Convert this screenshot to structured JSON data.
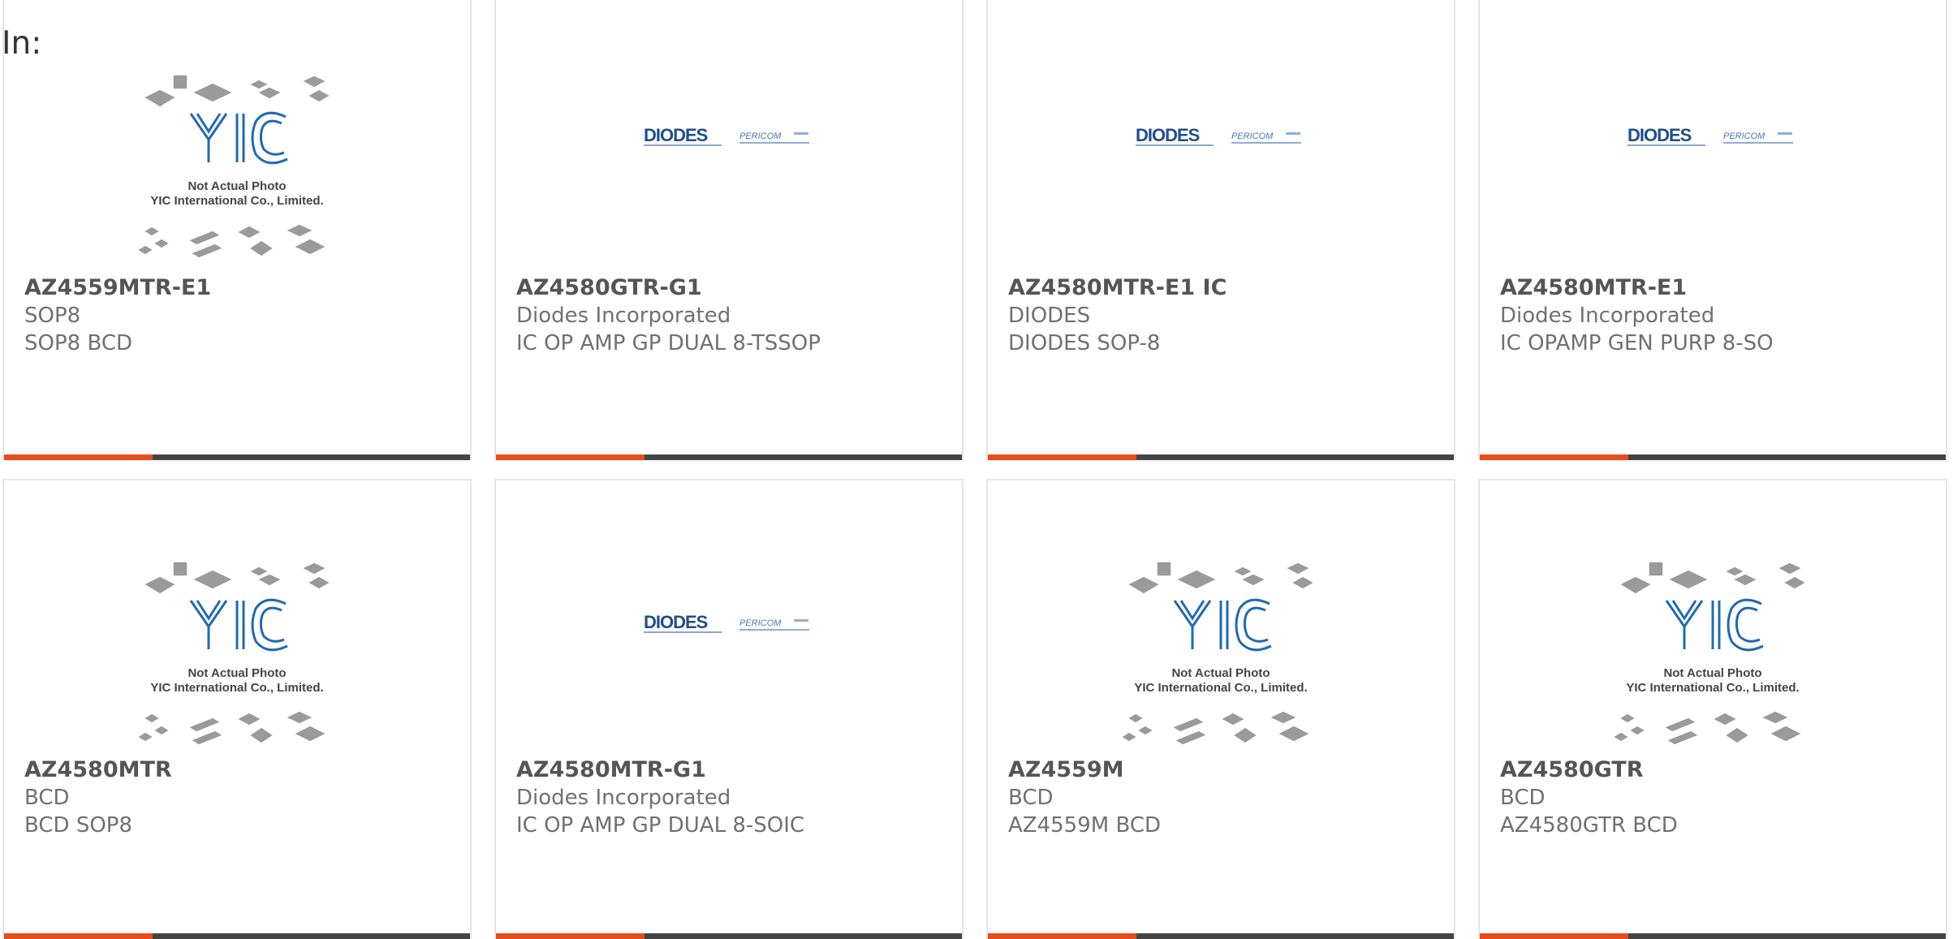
{
  "filter_label": "In:",
  "accent_color": "#e84b1c",
  "bar_color": "#444444",
  "yic_photo": {
    "line1": "Not Actual Photo",
    "line2": "YIC International Co., Limited.",
    "logo_text": "YIC"
  },
  "diodes_logo": {
    "brand": "DIODES",
    "sub": "PERICOM"
  },
  "products": [
    {
      "part": "AZ4559MTR-E1",
      "manufacturer": "SOP8",
      "description": "SOP8 BCD",
      "image": "yic"
    },
    {
      "part": "AZ4580GTR-G1",
      "manufacturer": "Diodes Incorporated",
      "description": "IC OP AMP GP DUAL 8-TSSOP",
      "image": "diodes"
    },
    {
      "part": "AZ4580MTR-E1 IC",
      "manufacturer": "DIODES",
      "description": "DIODES SOP-8",
      "image": "diodes"
    },
    {
      "part": "AZ4580MTR-E1",
      "manufacturer": "Diodes Incorporated",
      "description": "IC OPAMP GEN PURP 8-SO",
      "image": "diodes"
    },
    {
      "part": "AZ4580MTR",
      "manufacturer": "BCD",
      "description": "BCD SOP8",
      "image": "yic"
    },
    {
      "part": "AZ4580MTR-G1",
      "manufacturer": "Diodes Incorporated",
      "description": "IC OP AMP GP DUAL 8-SOIC",
      "image": "diodes"
    },
    {
      "part": "AZ4559M",
      "manufacturer": "BCD",
      "description": "AZ4559M BCD",
      "image": "yic"
    },
    {
      "part": "AZ4580GTR",
      "manufacturer": "BCD",
      "description": "AZ4580GTR BCD",
      "image": "yic"
    }
  ]
}
